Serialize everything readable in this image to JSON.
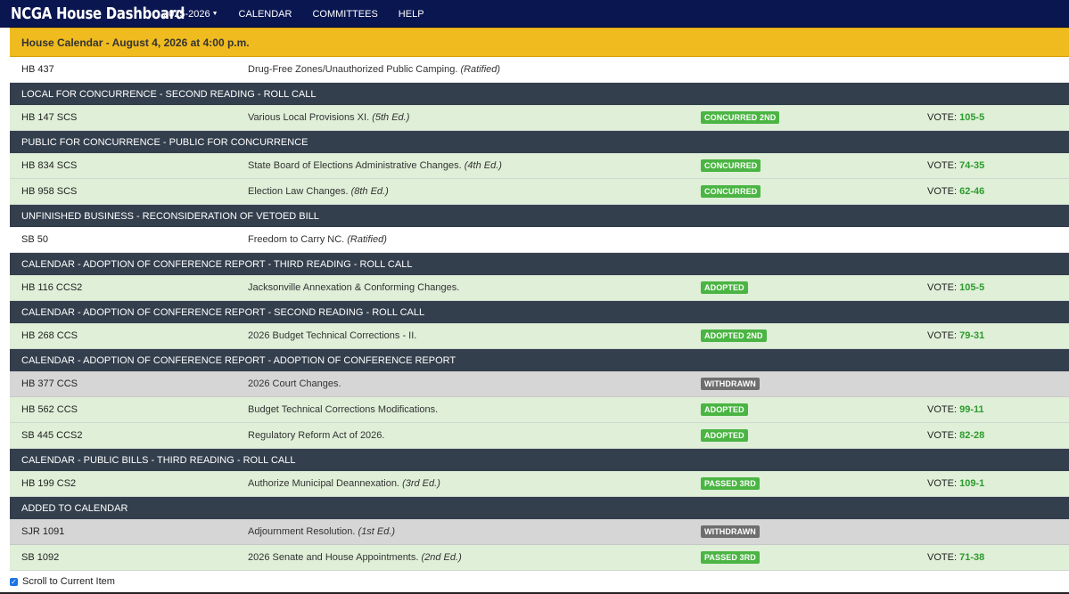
{
  "nav": {
    "brand": "NCGA House Dashboard",
    "session": "2025-2026",
    "calendar": "CALENDAR",
    "committees": "COMMITTEES",
    "help": "HELP"
  },
  "calendar_header": "House Calendar - August 4, 2026 at 4:00 p.m.",
  "rows": [
    {
      "type": "bill",
      "style": "white",
      "bill": "HB 437",
      "title": "Drug-Free Zones/Unauthorized Public Camping.",
      "edition": "(Ratified)",
      "badge": "",
      "badge_style": "",
      "vote_label": "",
      "vote": ""
    },
    {
      "type": "section",
      "label": "LOCAL FOR CONCURRENCE - SECOND READING - ROLL CALL"
    },
    {
      "type": "bill",
      "style": "green",
      "bill": "HB 147 SCS",
      "title": "Various Local Provisions XI.",
      "edition": "(5th Ed.)",
      "badge": "CONCURRED 2ND",
      "badge_style": "success",
      "vote_label": "VOTE:",
      "vote": "105-5"
    },
    {
      "type": "section",
      "label": "PUBLIC FOR CONCURRENCE - PUBLIC FOR CONCURRENCE"
    },
    {
      "type": "bill",
      "style": "green",
      "bill": "HB 834 SCS",
      "title": "State Board of Elections Administrative Changes.",
      "edition": "(4th Ed.)",
      "badge": "CONCURRED",
      "badge_style": "success",
      "vote_label": "VOTE:",
      "vote": "74-35"
    },
    {
      "type": "bill",
      "style": "green",
      "bill": "HB 958 SCS",
      "title": "Election Law Changes.",
      "edition": "(8th Ed.)",
      "badge": "CONCURRED",
      "badge_style": "success",
      "vote_label": "VOTE:",
      "vote": "62-46"
    },
    {
      "type": "section",
      "label": "UNFINISHED BUSINESS - RECONSIDERATION OF VETOED BILL"
    },
    {
      "type": "bill",
      "style": "white",
      "bill": "SB 50",
      "title": "Freedom to Carry NC.",
      "edition": "(Ratified)",
      "badge": "",
      "badge_style": "",
      "vote_label": "",
      "vote": ""
    },
    {
      "type": "section",
      "label": "CALENDAR - ADOPTION OF CONFERENCE REPORT - THIRD READING - ROLL CALL"
    },
    {
      "type": "bill",
      "style": "green",
      "bill": "HB 116 CCS2",
      "title": "Jacksonville Annexation & Conforming Changes.",
      "edition": "",
      "badge": "ADOPTED",
      "badge_style": "success",
      "vote_label": "VOTE:",
      "vote": "105-5"
    },
    {
      "type": "section",
      "label": "CALENDAR - ADOPTION OF CONFERENCE REPORT - SECOND READING - ROLL CALL"
    },
    {
      "type": "bill",
      "style": "green",
      "bill": "HB 268 CCS",
      "title": "2026 Budget Technical Corrections - II.",
      "edition": "",
      "badge": "ADOPTED 2ND",
      "badge_style": "success",
      "vote_label": "VOTE:",
      "vote": "79-31"
    },
    {
      "type": "section",
      "label": "CALENDAR - ADOPTION OF CONFERENCE REPORT - ADOPTION OF CONFERENCE REPORT"
    },
    {
      "type": "bill",
      "style": "gray",
      "bill": "HB 377 CCS",
      "title": "2026 Court Changes.",
      "edition": "",
      "badge": "WITHDRAWN",
      "badge_style": "gray",
      "vote_label": "",
      "vote": ""
    },
    {
      "type": "bill",
      "style": "green",
      "bill": "HB 562 CCS",
      "title": "Budget Technical Corrections Modifications.",
      "edition": "",
      "badge": "ADOPTED",
      "badge_style": "success",
      "vote_label": "VOTE:",
      "vote": "99-11"
    },
    {
      "type": "bill",
      "style": "green",
      "bill": "SB 445 CCS2",
      "title": "Regulatory Reform Act of 2026.",
      "edition": "",
      "badge": "ADOPTED",
      "badge_style": "success",
      "vote_label": "VOTE:",
      "vote": "82-28"
    },
    {
      "type": "section",
      "label": "CALENDAR - PUBLIC BILLS - THIRD READING - ROLL CALL"
    },
    {
      "type": "bill",
      "style": "green",
      "bill": "HB 199 CS2",
      "title": "Authorize Municipal Deannexation.",
      "edition": "(3rd Ed.)",
      "badge": "PASSED 3RD",
      "badge_style": "success",
      "vote_label": "VOTE:",
      "vote": "109-1"
    },
    {
      "type": "section",
      "label": "ADDED TO CALENDAR"
    },
    {
      "type": "bill",
      "style": "gray",
      "bill": "SJR 1091",
      "title": "Adjournment Resolution.",
      "edition": "(1st Ed.)",
      "badge": "WITHDRAWN",
      "badge_style": "gray",
      "vote_label": "",
      "vote": ""
    },
    {
      "type": "bill",
      "style": "green",
      "bill": "SB 1092",
      "title": "2026 Senate and House Appointments.",
      "edition": "(2nd Ed.)",
      "badge": "PASSED 3RD",
      "badge_style": "success",
      "vote_label": "VOTE:",
      "vote": "71-38"
    }
  ],
  "footer": {
    "scroll_label": "Scroll to Current Item",
    "checked_mark": "✓"
  },
  "colors": {
    "navbar": "#0a1650",
    "header_gold": "#f0bb1e",
    "section": "#333f4d",
    "row_green": "#dfefd8",
    "row_gray": "#d6d6d6",
    "badge_green": "#4bb543",
    "badge_gray": "#6e6e6e",
    "vote_green": "#2d9b2d"
  }
}
